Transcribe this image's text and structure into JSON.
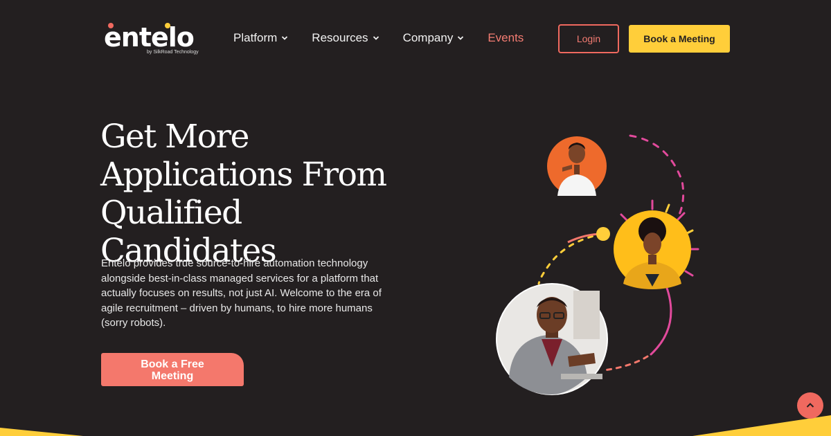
{
  "brand": {
    "logo_text": "entelo",
    "tagline": "by SilkRoad Technology"
  },
  "nav": {
    "items": [
      {
        "label": "Platform",
        "dropdown": true
      },
      {
        "label": "Resources",
        "dropdown": true
      },
      {
        "label": "Company",
        "dropdown": true
      },
      {
        "label": "Events",
        "dropdown": false
      }
    ],
    "login_label": "Login",
    "book_label": "Book a Meeting"
  },
  "hero": {
    "title": "Get More Applications From Qualified Candidates",
    "body": "Entelo provides true source-to-hire automation technology alongside best-in-class managed services for a platform that actually focuses on results, not just AI. Welcome to the era of agile recruitment – driven by humans, to hire more humans (sorry robots).",
    "cta_label": "Book a Free Meeting"
  },
  "colors": {
    "background": "#231f20",
    "accent_coral": "#f0695f",
    "accent_yellow": "#ffce3a",
    "accent_pink": "#e24a9c"
  },
  "icons": {
    "scroll_top": "chevron-up-icon",
    "nav_dropdown": "chevron-down-icon"
  }
}
